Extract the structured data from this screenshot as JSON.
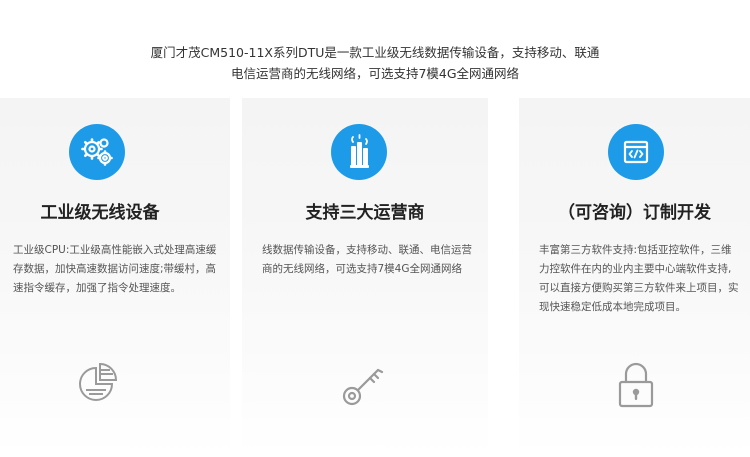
{
  "intro": {
    "line1": "厦门才茂CM510-11X系列DTU是一款工业级无线数据传输设备，支持移动、联通",
    "line2": "电信运营商的无线网络，可选支持7模4G全网通网络"
  },
  "cards": [
    {
      "icon": "gears-icon",
      "title": "工业级无线设备",
      "desc": "工业级CPU:工业级高性能嵌入式处理高速缓存数据，加快高速数据访问速度;带缓村，高速指令缓存，加强了指令处理速度。",
      "bottom_icon": "pie-chart-icon"
    },
    {
      "icon": "signal-tower-icon",
      "title": "支持三大运营商",
      "desc": "线数据传输设备，支持移动、联通、电信运营商的无线网络，可选支持7模4G全网通网络",
      "bottom_icon": "key-icon"
    },
    {
      "icon": "code-window-icon",
      "title": "（可咨询）订制开发",
      "desc": "丰富第三方软件支持:包括亚控软件，三维力控软件在内的业内主要中心端软件支持,可以直接方便购买第三方软件来上项目，实现快速稳定低成本地完成项目。",
      "bottom_icon": "lock-icon"
    }
  ],
  "colors": {
    "accent": "#1e9be8",
    "icon_gray": "#9a9a9a"
  }
}
